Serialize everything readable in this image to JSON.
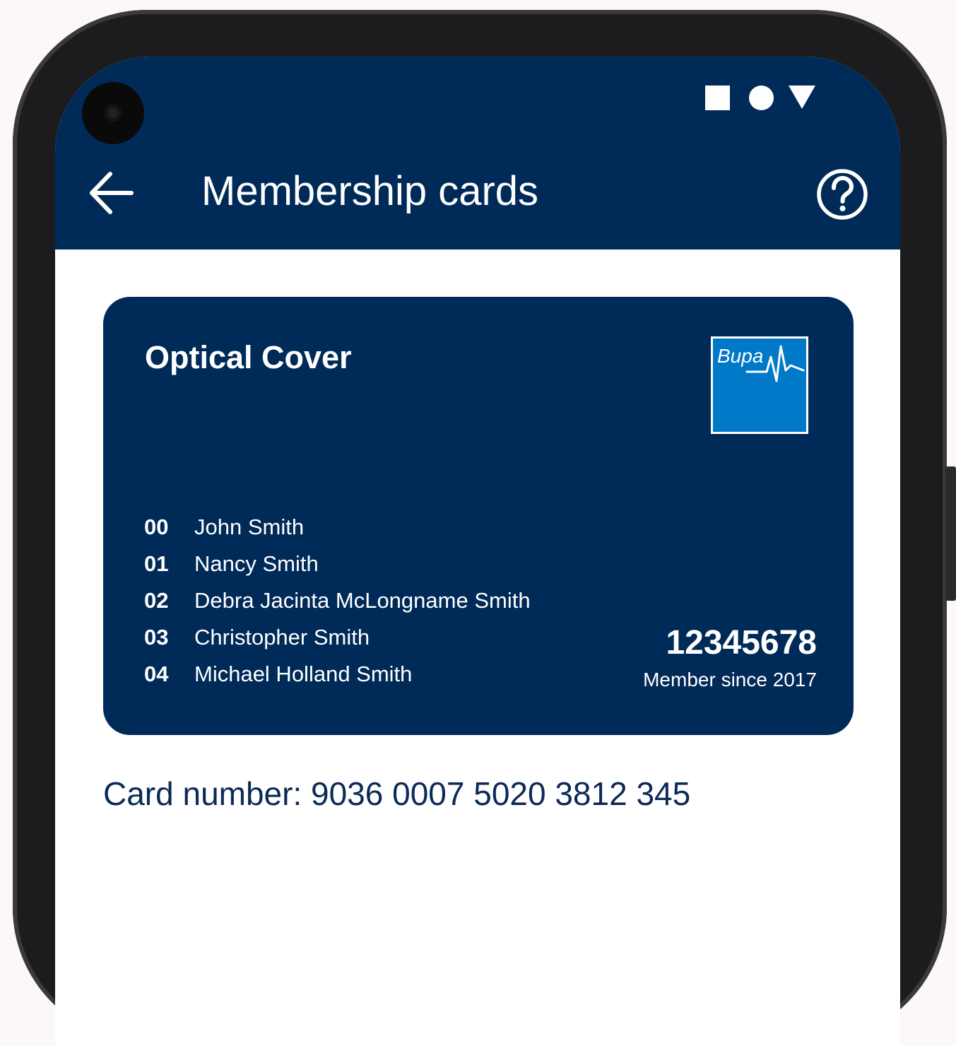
{
  "status_bar": {
    "icons": [
      "square-icon",
      "circle-icon",
      "triangle-icon"
    ]
  },
  "header": {
    "title": "Membership cards",
    "back_icon": "back-arrow-icon",
    "help_icon": "help-icon"
  },
  "card": {
    "title": "Optical Cover",
    "logo_text": "Bupa",
    "members": [
      {
        "id": "00",
        "name": "John Smith"
      },
      {
        "id": "01",
        "name": "Nancy Smith"
      },
      {
        "id": "02",
        "name": "Debra Jacinta McLongname Smith"
      },
      {
        "id": "03",
        "name": "Christopher Smith"
      },
      {
        "id": "04",
        "name": "Michael Holland Smith"
      }
    ],
    "member_number": "12345678",
    "member_since": "Member since 2017"
  },
  "card_number": "Card number: 9036 0007 5020 3812 345",
  "colors": {
    "header_bg": "#002a57",
    "card_bg": "#002a57",
    "logo_bg": "#0079c8",
    "card_number_text": "#0b2a57"
  }
}
